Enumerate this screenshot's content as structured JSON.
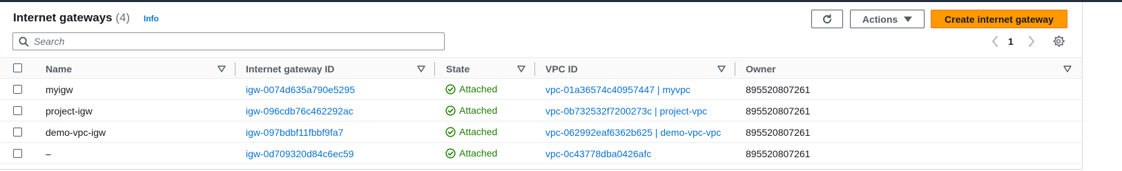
{
  "header": {
    "title": "Internet gateways",
    "count": "(4)",
    "info": "Info",
    "actions_label": "Actions",
    "create_label": "Create internet gateway"
  },
  "search": {
    "placeholder": "Search",
    "value": ""
  },
  "pagination": {
    "current_page": "1"
  },
  "columns": {
    "name": "Name",
    "igw_id": "Internet gateway ID",
    "state": "State",
    "vpc_id": "VPC ID",
    "owner": "Owner"
  },
  "rows": [
    {
      "name": "myigw",
      "igw_id": "igw-0074d635a790e5295",
      "state": "Attached",
      "vpc_id": "vpc-01a36574c40957447 | myvpc",
      "owner": "895520807261"
    },
    {
      "name": "project-igw",
      "igw_id": "igw-096cdb76c462292ac",
      "state": "Attached",
      "vpc_id": "vpc-0b732532f7200273c | project-vpc",
      "owner": "895520807261"
    },
    {
      "name": "demo-vpc-igw",
      "igw_id": "igw-097bdbf11fbbf9fa7",
      "state": "Attached",
      "vpc_id": "vpc-062992eaf6362b625 | demo-vpc-vpc",
      "owner": "895520807261"
    },
    {
      "name": "–",
      "igw_id": "igw-0d709320d84c6ec59",
      "state": "Attached",
      "vpc_id": "vpc-0c43778dba0426afc",
      "owner": "895520807261"
    }
  ],
  "colors": {
    "accent": "#0972d3",
    "primary_button": "#ff9900",
    "success": "#1d8102",
    "text": "#16191f",
    "muted": "#545b64"
  },
  "icons": {
    "refresh": "refresh-icon",
    "actions_caret": "caret-down-icon",
    "search": "search-icon",
    "prev": "chevron-left-icon",
    "next": "chevron-right-icon",
    "settings": "gear-icon",
    "sort": "sort-caret-icon",
    "state": "check-circle-icon"
  }
}
